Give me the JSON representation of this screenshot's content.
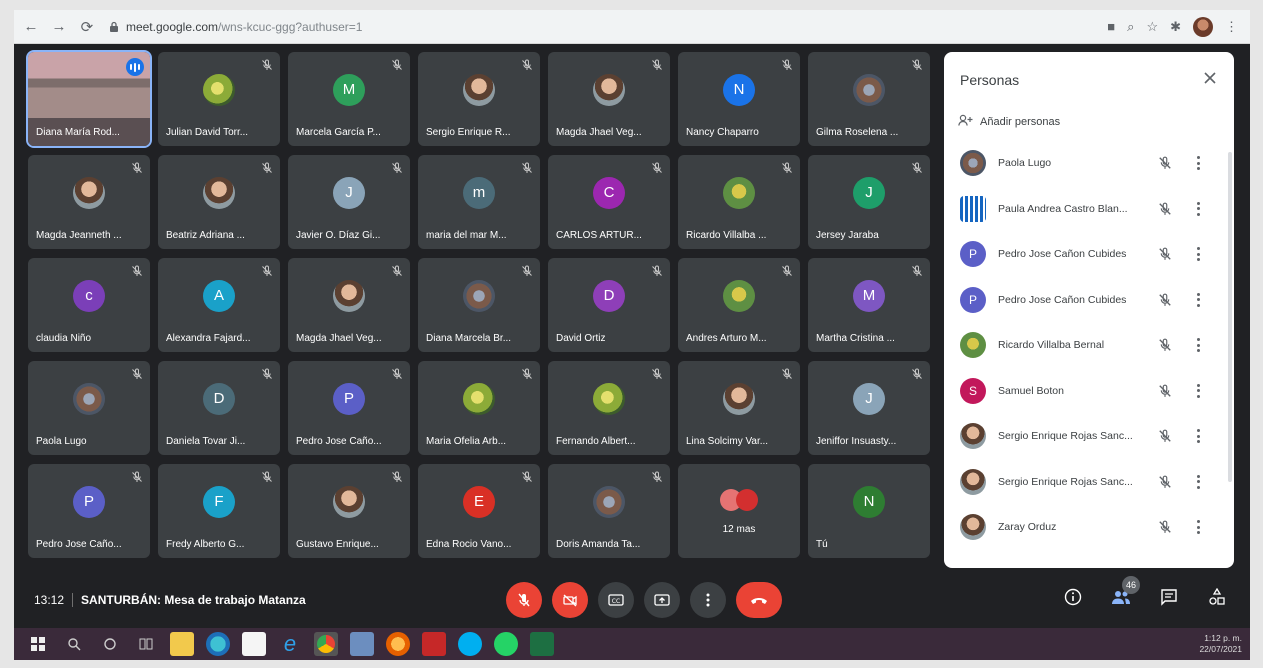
{
  "browser": {
    "url_main": "meet.google.com",
    "url_path": "/wns-kcuc-ggg?authuser=1"
  },
  "tiles": [
    {
      "name": "Diana María Rod...",
      "type": "room",
      "active": true,
      "speaking": true
    },
    {
      "name": "Julian David Torr...",
      "type": "photo-flower"
    },
    {
      "name": "Marcela García P...",
      "type": "letter",
      "letter": "M",
      "color": "#2e9f5b"
    },
    {
      "name": "Sergio Enrique R...",
      "type": "photo"
    },
    {
      "name": "Magda Jhael Veg...",
      "type": "photo"
    },
    {
      "name": "Nancy Chaparro",
      "type": "letter",
      "letter": "N",
      "color": "#1a73e8"
    },
    {
      "name": "Gilma Roselena ...",
      "type": "photo-group"
    },
    {
      "name": "Magda Jeanneth ...",
      "type": "photo"
    },
    {
      "name": "Beatriz Adriana ...",
      "type": "photo"
    },
    {
      "name": "Javier O. Díaz Gi...",
      "type": "letter",
      "letter": "J",
      "color": "#8aa4b8"
    },
    {
      "name": "maria del mar M...",
      "type": "letter",
      "letter": "m",
      "color": "#4b6b78"
    },
    {
      "name": "CARLOS ARTUR...",
      "type": "letter",
      "letter": "C",
      "color": "#9c27b0"
    },
    {
      "name": "Ricardo Villalba ...",
      "type": "photo-green"
    },
    {
      "name": "Jersey Jaraba",
      "type": "letter",
      "letter": "J",
      "color": "#1e9e6a"
    },
    {
      "name": "claudia Niño",
      "type": "letter",
      "letter": "c",
      "color": "#7b3fb8"
    },
    {
      "name": "Alexandra Fajard...",
      "type": "letter",
      "letter": "A",
      "color": "#1aa1c9"
    },
    {
      "name": "Magda Jhael Veg...",
      "type": "photo"
    },
    {
      "name": "Diana Marcela Br...",
      "type": "photo-group"
    },
    {
      "name": "David Ortiz",
      "type": "letter",
      "letter": "D",
      "color": "#8e3fb8"
    },
    {
      "name": "Andres Arturo M...",
      "type": "photo-green"
    },
    {
      "name": "Martha Cristina ...",
      "type": "letter",
      "letter": "M",
      "color": "#7e57c2"
    },
    {
      "name": "Paola Lugo",
      "type": "photo-group"
    },
    {
      "name": "Daniela Tovar Ji...",
      "type": "letter",
      "letter": "D",
      "color": "#4b6b78"
    },
    {
      "name": "Pedro Jose Caño...",
      "type": "letter",
      "letter": "P",
      "color": "#5b5fc7"
    },
    {
      "name": "Maria Ofelia Arb...",
      "type": "photo-flower"
    },
    {
      "name": "Fernando Albert...",
      "type": "photo-flower"
    },
    {
      "name": "Lina Solcimy Var...",
      "type": "photo"
    },
    {
      "name": "Jeniffor Insuasty...",
      "type": "letter",
      "letter": "J",
      "color": "#8aa4b8"
    },
    {
      "name": "Pedro Jose Caño...",
      "type": "letter",
      "letter": "P",
      "color": "#5b5fc7"
    },
    {
      "name": "Fredy Alberto G...",
      "type": "letter",
      "letter": "F",
      "color": "#1aa1c9"
    },
    {
      "name": "Gustavo Enrique...",
      "type": "photo"
    },
    {
      "name": "Edna Rocio Vano...",
      "type": "letter",
      "letter": "E",
      "color": "#d93025"
    },
    {
      "name": "Doris Amanda Ta...",
      "type": "photo-group"
    },
    {
      "name": "12 mas",
      "type": "more"
    },
    {
      "name": "Tú",
      "type": "letter",
      "letter": "N",
      "color": "#2e7d32"
    }
  ],
  "panel": {
    "title": "Personas",
    "add_label": "Añadir personas",
    "people": [
      {
        "name": "Paola Lugo",
        "type": "photo-group"
      },
      {
        "name": "Paula Andrea Castro Blan...",
        "type": "logo"
      },
      {
        "name": "Pedro Jose Cañon Cubides",
        "type": "letter",
        "letter": "P",
        "color": "#5b5fc7"
      },
      {
        "name": "Pedro Jose Cañon Cubides",
        "type": "letter",
        "letter": "P",
        "color": "#5b5fc7"
      },
      {
        "name": "Ricardo Villalba Bernal",
        "type": "photo-green"
      },
      {
        "name": "Samuel Boton",
        "type": "letter",
        "letter": "S",
        "color": "#c2185b"
      },
      {
        "name": "Sergio Enrique Rojas Sanc...",
        "type": "photo"
      },
      {
        "name": "Sergio Enrique Rojas Sanc...",
        "type": "photo"
      },
      {
        "name": "Zaray Orduz",
        "type": "photo"
      }
    ]
  },
  "bottom": {
    "time": "13:12",
    "title": "SANTURBÁN: Mesa de trabajo Matanza",
    "participants_count": "46"
  },
  "taskbar": {
    "clock_time": "1:12 p. m.",
    "clock_date": "22/07/2021"
  }
}
